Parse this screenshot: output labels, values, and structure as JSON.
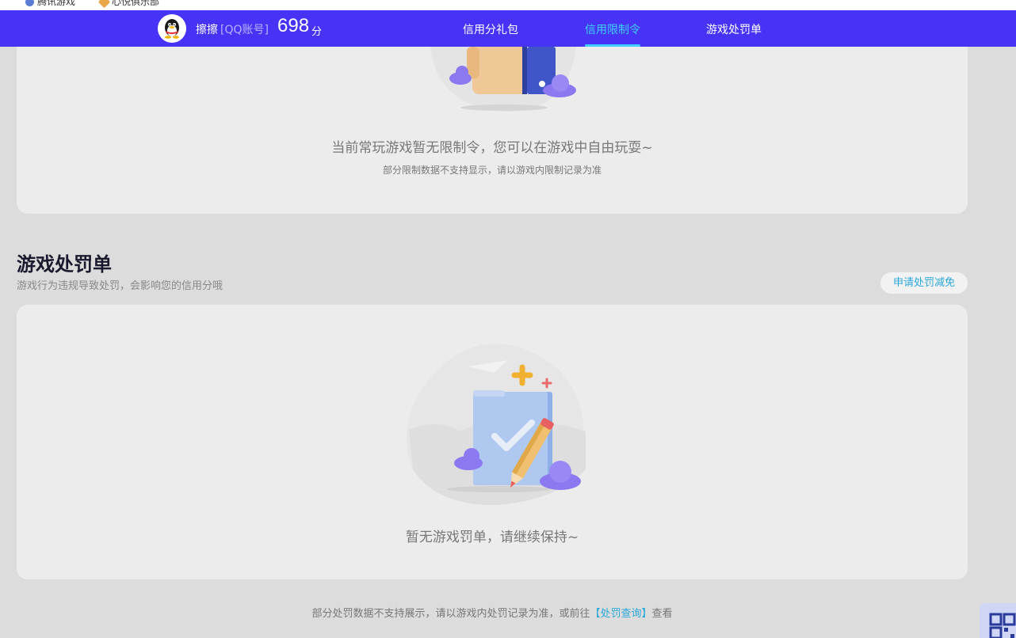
{
  "bookmarks": [
    {
      "label": "腾讯游戏",
      "icon": "globe-icon"
    },
    {
      "label": "心悦俱乐部",
      "icon": "diamond-icon"
    }
  ],
  "header": {
    "username": "擦擦",
    "account_type": "[QQ账号]",
    "score": "698",
    "score_unit": "分",
    "tabs": [
      {
        "label": "信用分礼包",
        "active": false
      },
      {
        "label": "信用限制令",
        "active": true
      },
      {
        "label": "游戏处罚单",
        "active": false
      }
    ]
  },
  "restriction": {
    "empty_text": "当前常玩游戏暂无限制令，您可以在游戏中自由玩耍~",
    "note": "部分限制数据不支持显示，请以游戏内限制记录为准"
  },
  "penalty": {
    "title": "游戏处罚单",
    "subtitle": "游戏行为违规导致处罚，会影响您的信用分哦",
    "appeal_button": "申请处罚减免",
    "empty_text": "暂无游戏罚单，请继续保持~"
  },
  "footer": {
    "note_prefix": "部分处罚数据不支持展示，请以游戏内处罚记录为准，或前往",
    "link": "【处罚查询】",
    "note_suffix": "查看"
  },
  "colors": {
    "nav_bg": "#4633f5",
    "accent": "#3ed0ff",
    "link": "#29a7d8",
    "page_bg": "#dcdcdc",
    "card_bg": "#ececec"
  }
}
